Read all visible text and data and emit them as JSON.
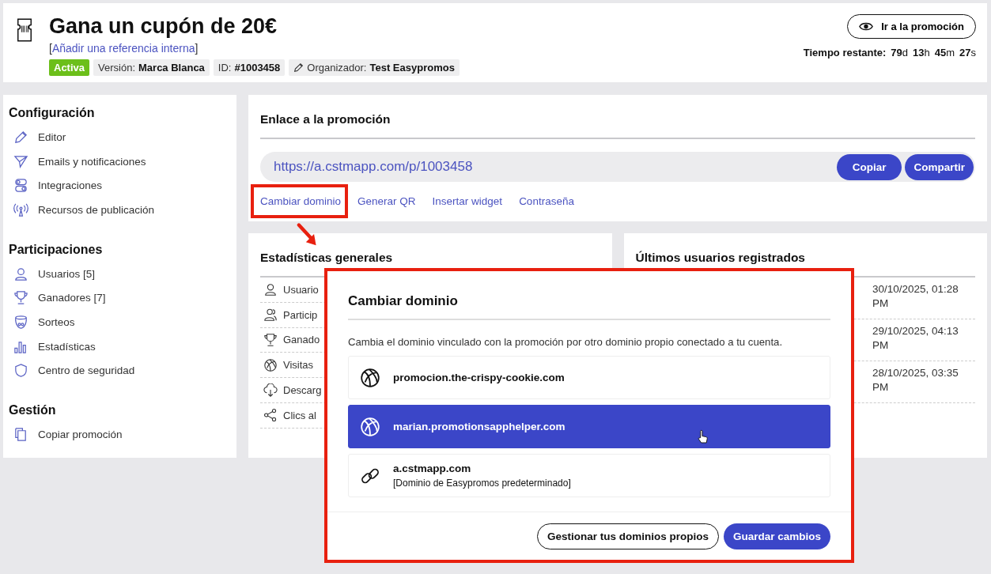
{
  "header": {
    "title": "Gana un cupón de 20€",
    "reference": {
      "open": "[",
      "link": "Añadir una referencia interna",
      "close": "]"
    },
    "status": "Activa",
    "tags": [
      {
        "kind": "plain",
        "label": "Versión:",
        "value": "Marca Blanca"
      },
      {
        "kind": "plain",
        "label": "ID:",
        "value": "#1003458"
      },
      {
        "kind": "pencil",
        "label": "Organizador:",
        "value": "Test Easypromos"
      }
    ],
    "action": "Ir a la promoción",
    "remaining": {
      "label": "Tiempo restante:",
      "parts": [
        {
          "value": "79",
          "unit": "d"
        },
        {
          "value": "13",
          "unit": "h"
        },
        {
          "value": "45",
          "unit": "m"
        },
        {
          "value": "27",
          "unit": "s"
        }
      ]
    }
  },
  "sidebar": {
    "sections": [
      {
        "title": "Configuración",
        "items": [
          {
            "kind": "pencil",
            "label": "Editor"
          },
          {
            "kind": "send",
            "label": "Emails y notificaciones"
          },
          {
            "kind": "toggles",
            "label": "Integraciones"
          },
          {
            "kind": "antenna",
            "label": "Recursos de publicación"
          }
        ]
      },
      {
        "title": "Participaciones",
        "items": [
          {
            "kind": "user",
            "label": "Usuarios [5]"
          },
          {
            "kind": "trophy",
            "label": "Ganadores [7]"
          },
          {
            "kind": "bowl",
            "label": "Sorteos"
          },
          {
            "kind": "bars",
            "label": "Estadísticas"
          },
          {
            "kind": "shield",
            "label": "Centro de seguridad"
          }
        ]
      },
      {
        "title": "Gestión",
        "items": [
          {
            "kind": "copy",
            "label": "Copiar promoción"
          }
        ]
      }
    ]
  },
  "link_card": {
    "title": "Enlace a la promoción",
    "url": "https://a.cstmapp.com/p/1003458",
    "buttons": [
      "Copiar",
      "Compartir"
    ],
    "links": [
      {
        "label": "Cambiar dominio",
        "highlighted": true
      },
      {
        "label": "Generar QR",
        "highlighted": false
      },
      {
        "label": "Insertar widget",
        "highlighted": false
      },
      {
        "label": "Contraseña",
        "highlighted": false
      }
    ]
  },
  "stats_card": {
    "title": "Estadísticas generales",
    "rows": [
      {
        "kind": "user",
        "label": "Usuario"
      },
      {
        "kind": "users",
        "label": "Particip"
      },
      {
        "kind": "trophy",
        "label": "Ganado"
      },
      {
        "kind": "globe",
        "label": "Visitas"
      },
      {
        "kind": "download",
        "label": "Descarg"
      },
      {
        "kind": "share",
        "label": "Clics al"
      }
    ]
  },
  "users_card": {
    "title": "Últimos usuarios registrados",
    "rows": [
      "30/10/2025, 01:28 PM",
      "29/10/2025, 04:13 PM",
      "28/10/2025, 03:35 PM"
    ]
  },
  "modal": {
    "title": "Cambiar dominio",
    "description": "Cambia el dominio vinculado con la promoción por otro dominio propio conectado a tu cuenta.",
    "options": [
      {
        "kind": "globe",
        "name": "promocion.the-crispy-cookie.com",
        "selected": false
      },
      {
        "kind": "globe",
        "name": "marian.promotionsapphelper.com",
        "selected": true
      },
      {
        "kind": "link",
        "name": "a.cstmapp.com",
        "note": "[Dominio de Easypromos predeterminado]",
        "selected": false
      }
    ],
    "secondary_button": "Gestionar tus dominios propios",
    "primary_button": "Guardar cambios"
  }
}
